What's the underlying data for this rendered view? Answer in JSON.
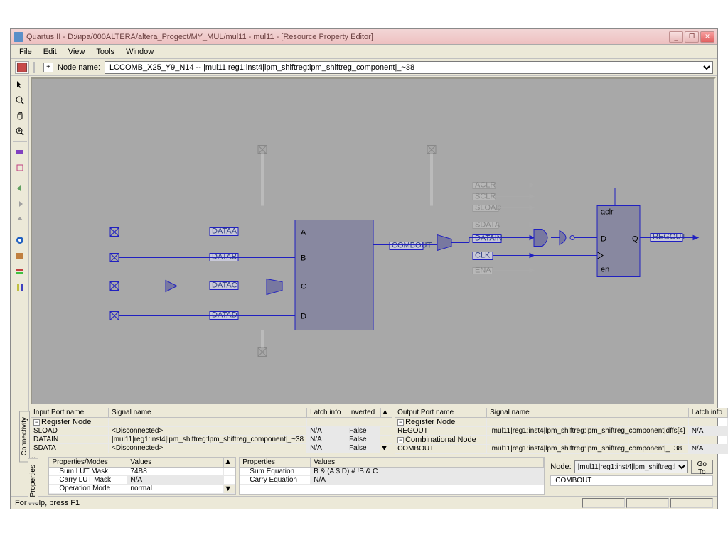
{
  "window": {
    "title": "Quartus II - D:/ира/000ALTERA/altera_Progect/MY_MUL/mul11 - mul11 - [Resource Property Editor]",
    "min": "_",
    "max": "❐",
    "close": "✕"
  },
  "menu": {
    "file": "File",
    "edit": "Edit",
    "view": "View",
    "tools": "Tools",
    "window": "Window"
  },
  "node_toolbar": {
    "label": "Node name:",
    "value": "LCCOMB_X25_Y9_N14 -- |mul11|reg1:inst4|lpm_shiftreg:lpm_shiftreg_component|_~38"
  },
  "schematic": {
    "labels": {
      "dataa": "DATAA",
      "datab": "DATAB",
      "datac": "DATAC",
      "datad": "DATAD",
      "combout": "COMBOUT",
      "datain": "DATAIN",
      "clk": "CLK",
      "regout": "REGOUT",
      "aclr": "aclr",
      "q": "Q",
      "d": "D",
      "en": "en",
      "a": "A",
      "b": "B",
      "c": "C",
      "u_aclr": "ACLR",
      "u_sclr": "SCLR",
      "u_sload": "SLOAD",
      "u_sdata": "SDATA",
      "u_ena": "ENA"
    }
  },
  "conn_panel": {
    "tab": "Connectivity",
    "left": {
      "cols": {
        "port": "Input Port name",
        "signal": "Signal name",
        "latch": "Latch info",
        "inv": "Inverted"
      },
      "reg_node": "Register Node",
      "rows": [
        {
          "port": "SLOAD",
          "signal": "<Disconnected>",
          "latch": "N/A",
          "inv": "False"
        },
        {
          "port": "DATAIN",
          "signal": "|mul11|reg1:inst4|lpm_shiftreg:lpm_shiftreg_component|_~38",
          "latch": "N/A",
          "inv": "False"
        },
        {
          "port": "SDATA",
          "signal": "<Disconnected>",
          "latch": "N/A",
          "inv": "False"
        }
      ]
    },
    "right": {
      "cols": {
        "port": "Output Port name",
        "signal": "Signal name",
        "latch": "Latch info"
      },
      "reg_node": "Register Node",
      "regout": {
        "port": "REGOUT",
        "signal": "|mul11|reg1:inst4|lpm_shiftreg:lpm_shiftreg_component|dffs[4]",
        "latch": "N/A"
      },
      "comb_node": "Combinational Node",
      "combout": {
        "port": "COMBOUT",
        "signal": "|mul11|reg1:inst4|lpm_shiftreg:lpm_shiftreg_component|_~38",
        "latch": "N/A"
      }
    }
  },
  "props_panel": {
    "tab": "Properties",
    "left": {
      "cols": {
        "pm": "Properties/Modes",
        "val": "Values"
      },
      "rows": [
        {
          "pm": "Sum LUT Mask",
          "val": "74B8"
        },
        {
          "pm": "Carry LUT Mask",
          "val": "N/A"
        },
        {
          "pm": "Operation Mode",
          "val": "normal"
        }
      ]
    },
    "mid": {
      "cols": {
        "p": "Properties",
        "val": "Values"
      },
      "rows": [
        {
          "p": "Sum Equation",
          "val": "B & (A $ D) # !B & C"
        },
        {
          "p": "Carry Equation",
          "val": "N/A"
        }
      ]
    },
    "right": {
      "node_lbl": "Node:",
      "node_val": "|mul11|reg1:inst4|lpm_shiftreg:l",
      "goto": "Go To",
      "combout": "COMBOUT"
    }
  },
  "status": {
    "help": "For Help, press F1"
  }
}
